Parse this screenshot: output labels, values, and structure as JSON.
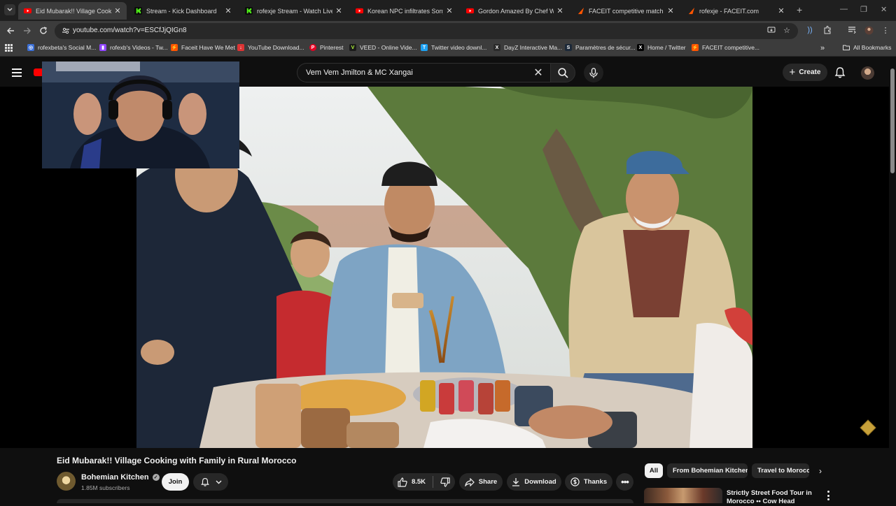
{
  "browser": {
    "tabs": [
      {
        "title": "Eid Mubarak!! Village Cooking w",
        "favicon": "youtube-icon",
        "active": true
      },
      {
        "title": "Stream - Kick Dashboard",
        "favicon": "kick-icon",
        "active": false
      },
      {
        "title": "rofexje Stream - Watch Live on",
        "favicon": "kick-icon",
        "active": false
      },
      {
        "title": "Korean NPC infiltrates Sony HQ",
        "favicon": "youtube-icon",
        "active": false
      },
      {
        "title": "Gordon Amazed By Chef Who M",
        "favicon": "youtube-icon",
        "active": false
      },
      {
        "title": "FACEIT competitive match - FAC",
        "favicon": "faceit-icon",
        "active": false
      },
      {
        "title": "rofexje - FACEIT.com",
        "favicon": "faceit-icon",
        "active": false
      }
    ],
    "url": "youtube.com/watch?v=ESCfJjQIGn8",
    "bookmarks": [
      {
        "label": "rofexbeta's Social M...",
        "icon": "globe-icon",
        "color": "#3b6fd6",
        "glyph": "◎"
      },
      {
        "label": "rofexb's Videos - Tw...",
        "icon": "twitch-icon",
        "color": "#9146ff",
        "glyph": "▮"
      },
      {
        "label": "Faceit Have We Met",
        "icon": "faceit-icon",
        "color": "#ff5500",
        "glyph": "⚡"
      },
      {
        "label": "YouTube Download...",
        "icon": "download-icon",
        "color": "#d33",
        "glyph": "↓"
      },
      {
        "label": "Pinterest",
        "icon": "pinterest-icon",
        "color": "#e60023",
        "glyph": "P"
      },
      {
        "label": "VEED - Online Vide...",
        "icon": "veed-icon",
        "color": "#1a1a1a",
        "glyph": "V"
      },
      {
        "label": "Twitter video downl...",
        "icon": "twitter-download-icon",
        "color": "#1da1f2",
        "glyph": "T"
      },
      {
        "label": "DayZ Interactive Ma...",
        "icon": "x-icon",
        "color": "#2a2a2a",
        "glyph": "X"
      },
      {
        "label": "Paramètres de sécur...",
        "icon": "steam-icon",
        "color": "#1b2838",
        "glyph": "S"
      },
      {
        "label": "Home / Twitter",
        "icon": "x-icon",
        "color": "#000000",
        "glyph": "X"
      },
      {
        "label": "FACEIT competitive...",
        "icon": "faceit-icon",
        "color": "#ff5500",
        "glyph": "⚡"
      }
    ],
    "all_bookmarks_label": "All Bookmarks"
  },
  "youtube": {
    "search_query": "Vem Vem Jmilton & MC Xangai",
    "create_label": "Create",
    "video": {
      "title": "Eid Mubarak!! Village Cooking with Family in Rural Morocco",
      "channel": "Bohemian Kitchen",
      "subscribers": "1.85M subscribers",
      "join_label": "Join",
      "likes": "8.5K",
      "share_label": "Share",
      "download_label": "Download",
      "thanks_label": "Thanks"
    },
    "chips": [
      "All",
      "From Bohemian Kitchen",
      "Travel to Morocco"
    ],
    "recommendation": {
      "title": "Strictly Street Food Tour in Morocco •• Cow Head"
    }
  },
  "colors": {
    "youtube_red": "#ff0000",
    "kick_green": "#53fc18",
    "faceit_orange": "#ff5500",
    "page_bg": "#0f0f0f",
    "chip_bg": "#272727"
  }
}
